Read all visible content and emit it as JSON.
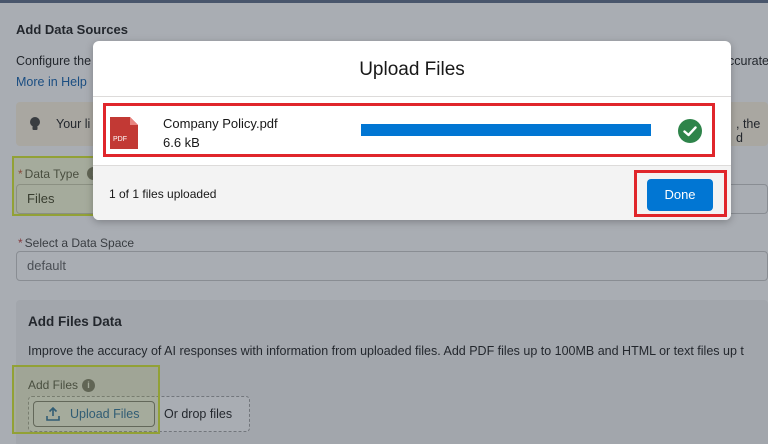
{
  "page": {
    "section_title": "Add Data Sources",
    "description_start": "Configure the",
    "description_end": "ccurate",
    "help_link": "More in Help",
    "tip_text": "Your li",
    "tip_text_end": ", the d",
    "data_type": {
      "label": "Data Type",
      "required_mark": "*",
      "value": "Files"
    },
    "data_space": {
      "label": "Select a Data Space",
      "required_mark": "*",
      "value": "default"
    },
    "files_section": {
      "title": "Add Files Data",
      "description": "Improve the accuracy of AI responses with information from uploaded files. Add PDF files up to 100MB and HTML or text files up t",
      "add_files_label": "Add Files",
      "upload_button": "Upload Files",
      "drop_text": "Or drop files"
    }
  },
  "modal": {
    "title": "Upload Files",
    "file": {
      "name": "Company Policy.pdf",
      "size": "6.6 kB",
      "icon_text": "PDF",
      "progress_percent": 100,
      "status_icon": "success-check-icon"
    },
    "status_text": "1 of 1 files uploaded",
    "done_button": "Done"
  },
  "colors": {
    "brand_blue": "#0176d3",
    "success_green": "#2e844a",
    "highlight_red": "#e0262b",
    "highlight_yellow": "#d7ea29",
    "pdf_red": "#c23934"
  }
}
